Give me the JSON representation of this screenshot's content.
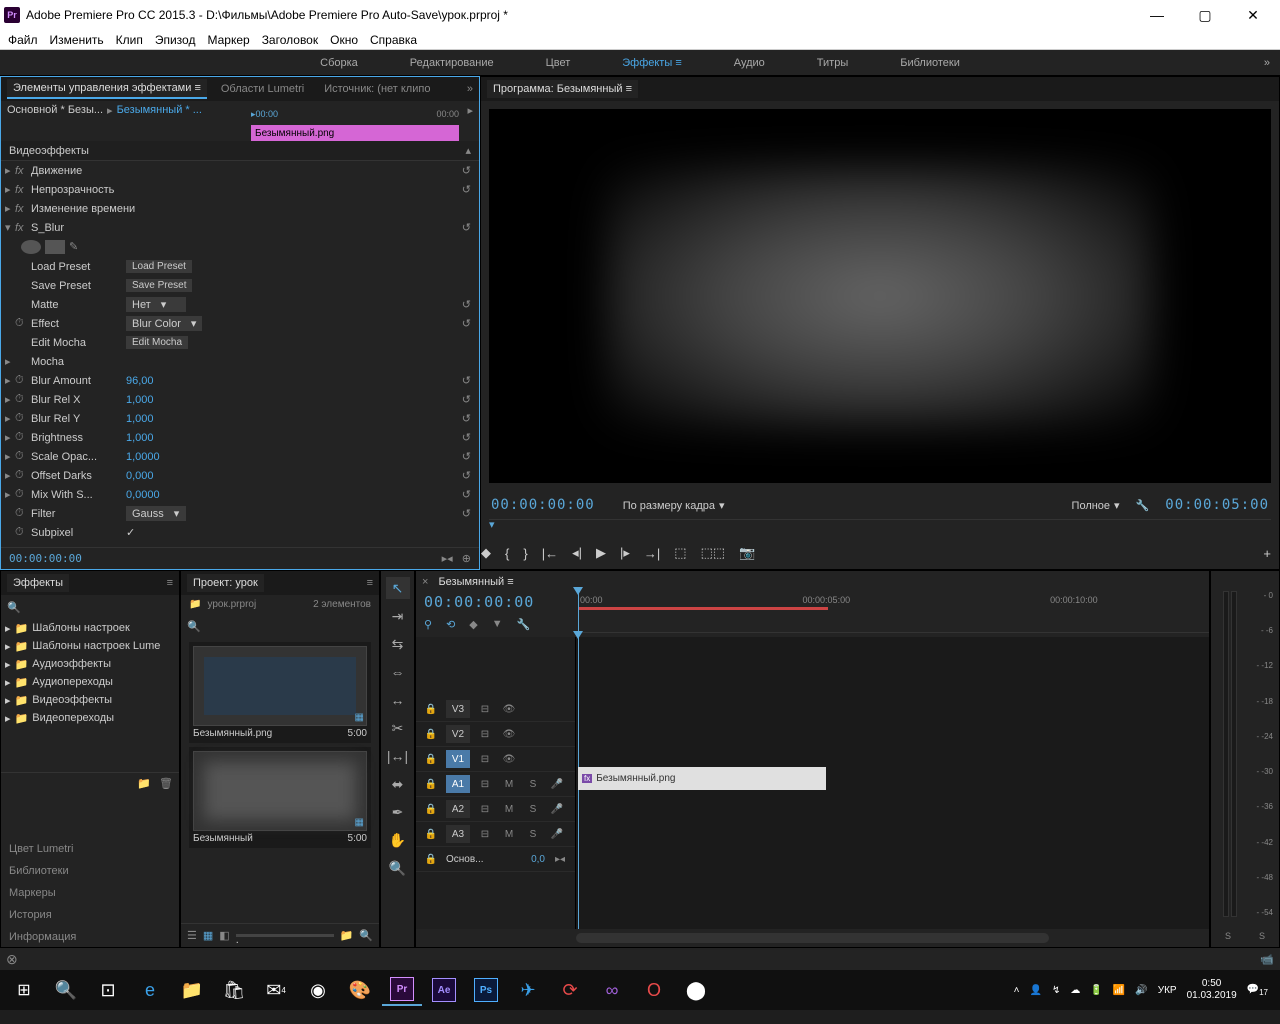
{
  "titlebar": {
    "app": "Adobe Premiere Pro CC 2015.3",
    "path": "D:\\Фильмы\\Adobe Premiere Pro Auto-Save\\урок.prproj *",
    "logo": "Pr"
  },
  "menubar": [
    "Файл",
    "Изменить",
    "Клип",
    "Эпизод",
    "Маркер",
    "Заголовок",
    "Окно",
    "Справка"
  ],
  "workspaces": [
    {
      "label": "Сборка",
      "active": false
    },
    {
      "label": "Редактирование",
      "active": false
    },
    {
      "label": "Цвет",
      "active": false
    },
    {
      "label": "Эффекты",
      "active": true
    },
    {
      "label": "Аудио",
      "active": false
    },
    {
      "label": "Титры",
      "active": false
    },
    {
      "label": "Библиотеки",
      "active": false
    }
  ],
  "effectControls": {
    "tabs": [
      {
        "label": "Элементы управления эффектами",
        "active": true
      },
      {
        "label": "Области Lumetri",
        "active": false
      },
      {
        "label": "Источник: (нет клипо",
        "active": false
      }
    ],
    "master": "Основной * Безы...",
    "clip": "Безымянный * ...",
    "ruler": {
      "start": "00:00",
      "end": "00:00"
    },
    "clipBar": "Безымянный.png",
    "section": "Видеоэффекты",
    "effects": [
      {
        "type": "fx",
        "label": "Движение"
      },
      {
        "type": "fx",
        "label": "Непрозрачность"
      },
      {
        "type": "fx-noreset",
        "label": "Изменение времени"
      },
      {
        "type": "fx-exp",
        "label": "S_Blur"
      }
    ],
    "params": [
      {
        "label": "Load Preset",
        "ctrl": "button",
        "btn": "Load Preset"
      },
      {
        "label": "Save Preset",
        "ctrl": "button",
        "btn": "Save Preset"
      },
      {
        "label": "Matte",
        "ctrl": "dropdown",
        "val": "Нет"
      },
      {
        "label": "Effect",
        "ctrl": "dropdown",
        "val": "Blur Color",
        "clock": true
      },
      {
        "label": "Edit Mocha",
        "ctrl": "button",
        "btn": "Edit Mocha"
      },
      {
        "label": "Mocha",
        "ctrl": "none",
        "arrow": true
      },
      {
        "label": "Blur Amount",
        "ctrl": "value",
        "val": "96,00",
        "clock": true,
        "arrow": true
      },
      {
        "label": "Blur Rel X",
        "ctrl": "value",
        "val": "1,000",
        "clock": true,
        "arrow": true
      },
      {
        "label": "Blur Rel Y",
        "ctrl": "value",
        "val": "1,000",
        "clock": true,
        "arrow": true
      },
      {
        "label": "Brightness",
        "ctrl": "value",
        "val": "1,000",
        "clock": true,
        "arrow": true
      },
      {
        "label": "Scale Opac...",
        "ctrl": "value",
        "val": "1,0000",
        "clock": true,
        "arrow": true
      },
      {
        "label": "Offset Darks",
        "ctrl": "value",
        "val": "0,000",
        "clock": true,
        "arrow": true
      },
      {
        "label": "Mix With S...",
        "ctrl": "value",
        "val": "0,0000",
        "clock": true,
        "arrow": true
      },
      {
        "label": "Filter",
        "ctrl": "dropdown",
        "val": "Gauss",
        "clock": true
      },
      {
        "label": "Subpixel",
        "ctrl": "check",
        "clock": true
      }
    ],
    "footerTime": "00:00:00:00"
  },
  "programMonitor": {
    "title": "Программа: Безымянный",
    "timecodeLeft": "00:00:00:00",
    "fit": "По размеру кадра",
    "quality": "Полное",
    "timecodeRight": "00:00:05:00"
  },
  "effectsPanel": {
    "title": "Эффекты",
    "folders": [
      "Шаблоны настроек",
      "Шаблоны настроек Lume",
      "Аудиоэффекты",
      "Аудиопереходы",
      "Видеоэффекты",
      "Видеопереходы"
    ],
    "stacks": [
      "Цвет Lumetri",
      "Библиотеки",
      "Маркеры",
      "История",
      "Информация"
    ]
  },
  "projectPanel": {
    "title": "Проект: урок",
    "file": "урок.prproj",
    "count": "2 элементов",
    "items": [
      {
        "name": "Безымянный.png",
        "dur": "5:00"
      },
      {
        "name": "Безымянный",
        "dur": "5:00"
      }
    ]
  },
  "timeline": {
    "title": "Безымянный",
    "timecode": "00:00:00:00",
    "ruler": [
      "00:00",
      "00:00:05:00",
      "00:00:10:00"
    ],
    "videoTracks": [
      "V3",
      "V2",
      "V1"
    ],
    "audioTracks": [
      "A1",
      "A2",
      "A3"
    ],
    "masterTrack": "Основ...",
    "masterVal": "0,0",
    "clip": "Безымянный.png"
  },
  "audioMeter": {
    "scale": [
      "0",
      "-6",
      "-12",
      "-18",
      "-24",
      "-30",
      "-36",
      "-42",
      "-48",
      "-54"
    ],
    "channels": [
      "S",
      "S"
    ]
  },
  "taskbar": {
    "lang": "УКР",
    "time": "0:50",
    "date": "01.03.2019",
    "notif": "17"
  }
}
